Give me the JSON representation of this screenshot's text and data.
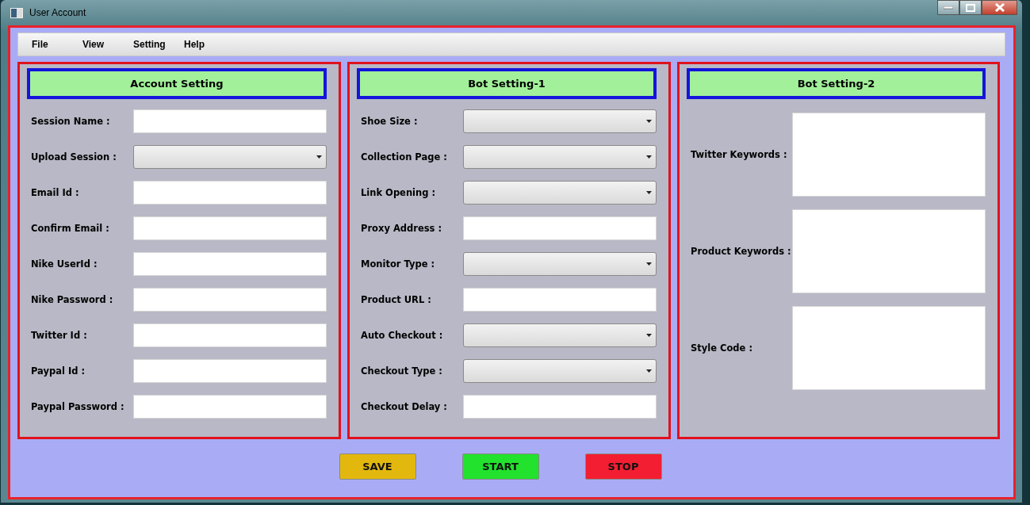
{
  "window": {
    "title": "User Account"
  },
  "menu": [
    "File",
    "View",
    "Setting",
    "Help"
  ],
  "panels": [
    {
      "title": "Account Setting",
      "fields": [
        {
          "label": "Session Name :",
          "kind": "text"
        },
        {
          "label": "Upload Session :",
          "kind": "dropdown"
        },
        {
          "label": "Email Id :",
          "kind": "text"
        },
        {
          "label": "Confirm Email :",
          "kind": "text"
        },
        {
          "label": "Nike UserId :",
          "kind": "text"
        },
        {
          "label": "Nike Password :",
          "kind": "text"
        },
        {
          "label": "Twitter Id :",
          "kind": "text"
        },
        {
          "label": "Paypal Id :",
          "kind": "text"
        },
        {
          "label": "Paypal Password :",
          "kind": "text"
        }
      ]
    },
    {
      "title": "Bot Setting-1",
      "fields": [
        {
          "label": "Shoe Size :",
          "kind": "dropdown"
        },
        {
          "label": "Collection Page :",
          "kind": "dropdown"
        },
        {
          "label": "Link Opening :",
          "kind": "dropdown"
        },
        {
          "label": "Proxy Address :",
          "kind": "text"
        },
        {
          "label": "Monitor Type :",
          "kind": "dropdown"
        },
        {
          "label": "Product URL :",
          "kind": "text"
        },
        {
          "label": "Auto Checkout :",
          "kind": "dropdown"
        },
        {
          "label": "Checkout Type :",
          "kind": "dropdown"
        },
        {
          "label": "Checkout Delay :",
          "kind": "text"
        }
      ]
    },
    {
      "title": "Bot Setting-2",
      "fields": [
        {
          "label": "Twitter Keywords :",
          "kind": "textarea"
        },
        {
          "label": "Product Keywords :",
          "kind": "textarea"
        },
        {
          "label": "Style Code :",
          "kind": "textarea"
        }
      ]
    }
  ],
  "buttons": [
    {
      "label": "SAVE",
      "color": "#e2b80e"
    },
    {
      "label": "START",
      "color": "#22e22e"
    },
    {
      "label": "STOP",
      "color": "#f41e32"
    }
  ]
}
